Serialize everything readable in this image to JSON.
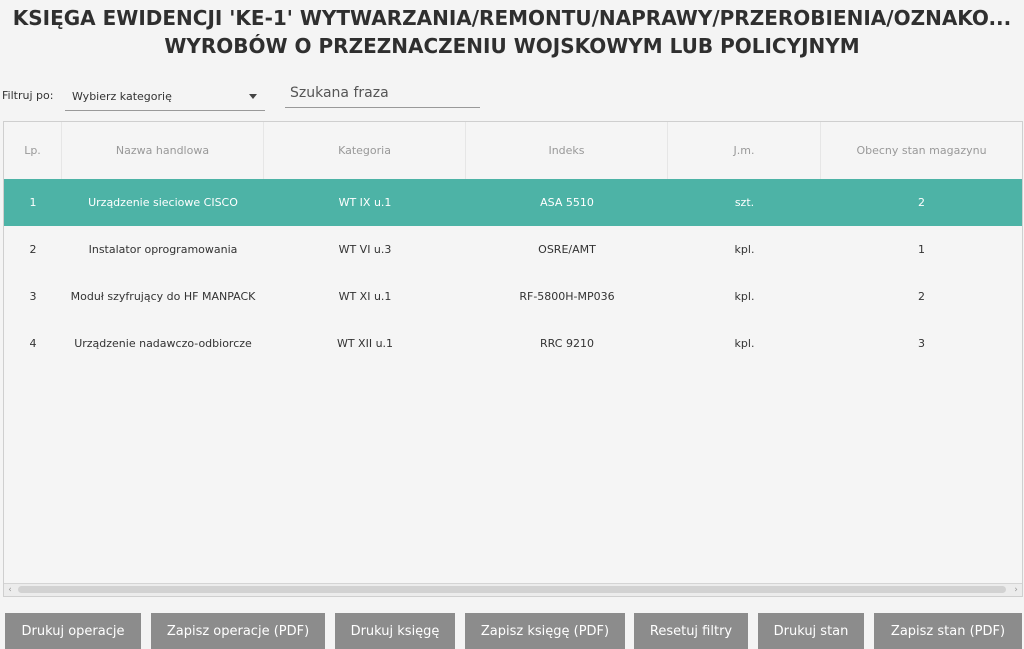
{
  "title": {
    "line1": "KSIĘGA EWIDENCJI 'KE-1' WYTWARZANIA/REMONTU/NAPRAWY/PRZEROBIENIA/OZNAKO...",
    "line2": "WYROBÓW O PRZEZNACZENIU WOJSKOWYM LUB POLICYJNYM"
  },
  "filter": {
    "label": "Filtruj po:",
    "category_value": "Wybierz kategorię",
    "search_placeholder": "Szukana fraza"
  },
  "table": {
    "columns": [
      "Lp.",
      "Nazwa handlowa",
      "Kategoria",
      "Indeks",
      "J.m.",
      "Obecny stan magazynu"
    ],
    "rows": [
      [
        "1",
        "Urządzenie sieciowe CISCO",
        "WT IX u.1",
        "ASA 5510",
        "szt.",
        "2"
      ],
      [
        "2",
        "Instalator oprogramowania",
        "WT VI u.3",
        "OSRE/AMT",
        "kpl.",
        "1"
      ],
      [
        "3",
        "Moduł szyfrujący do HF MANPACK",
        "WT XI u.1",
        "RF-5800H-MP036",
        "kpl.",
        "2"
      ],
      [
        "4",
        "Urządzenie nadawczo-odbiorcze",
        "WT XII u.1",
        "RRC 9210",
        "kpl.",
        "3"
      ]
    ],
    "selected_row": 0
  },
  "buttons": {
    "print_operations": "Drukuj operacje",
    "save_operations_pdf": "Zapisz operacje (PDF)",
    "print_book": "Drukuj księgę",
    "save_book_pdf": "Zapisz księgę (PDF)",
    "reset_filters": "Resetuj filtry",
    "print_stock": "Drukuj stan",
    "save_stock_pdf": "Zapisz stan (PDF)"
  },
  "colors": {
    "selected_row": "#4db3a6",
    "button_bg": "#8c8c8c"
  }
}
